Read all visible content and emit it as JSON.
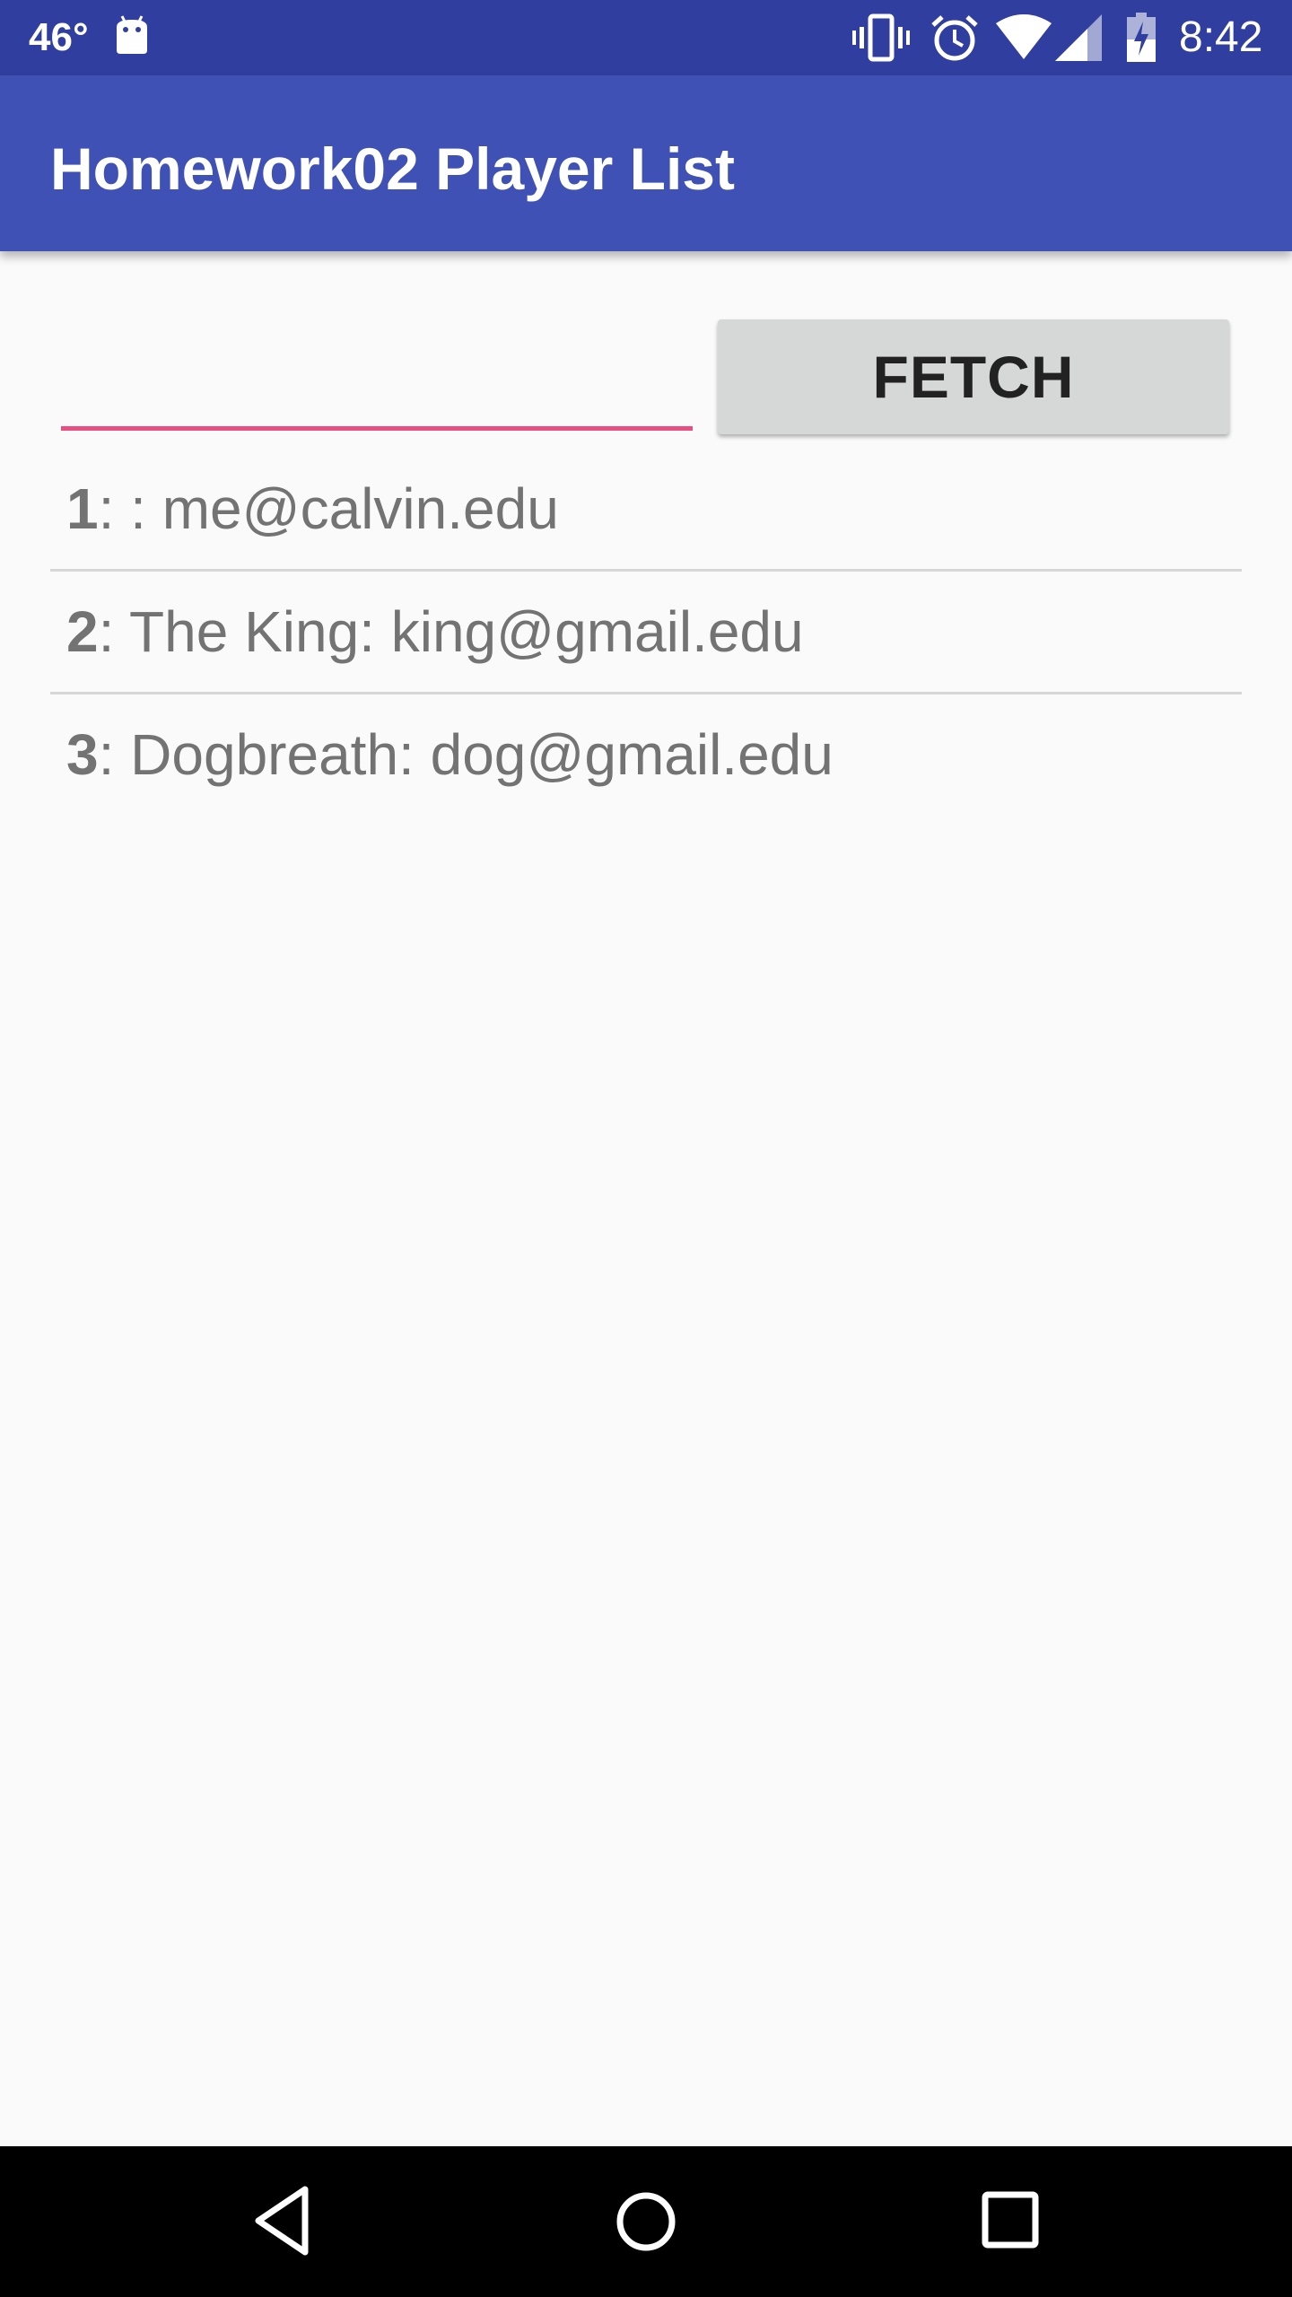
{
  "status_bar": {
    "temperature": "46°",
    "time": "8:42",
    "icons": [
      "android-icon",
      "vibrate-icon",
      "alarm-icon",
      "wifi-icon",
      "signal-icon",
      "battery-charging-icon"
    ]
  },
  "app_bar": {
    "title": "Homework02 Player List"
  },
  "input": {
    "value": "",
    "placeholder": ""
  },
  "fetch_button": {
    "label": "FETCH"
  },
  "players": [
    {
      "id": "1",
      "rest": ":  : me@calvin.edu"
    },
    {
      "id": "2",
      "rest": ": The King: king@gmail.edu"
    },
    {
      "id": "3",
      "rest": ": Dogbreath: dog@gmail.edu"
    }
  ],
  "nav_bar": {
    "icons": [
      "back-icon",
      "home-icon",
      "recents-icon"
    ]
  },
  "colors": {
    "status_bar": "#303f9f",
    "app_bar": "#3f51b5",
    "accent": "#e94e82",
    "background": "#fafafa",
    "button": "#d6d7d7",
    "list_text": "#737373"
  }
}
